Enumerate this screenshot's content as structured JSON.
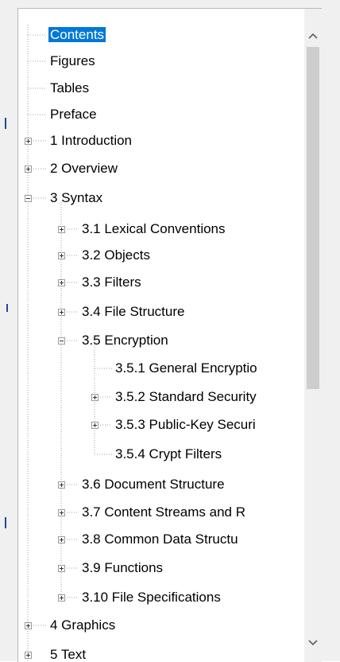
{
  "tree": {
    "nodes": [
      {
        "label": "Contents",
        "selected": true
      },
      {
        "label": "Figures"
      },
      {
        "label": "Tables"
      },
      {
        "label": "Preface"
      },
      {
        "label": "1 Introduction",
        "expander": "collapsed"
      },
      {
        "label": "2 Overview",
        "expander": "collapsed"
      },
      {
        "label": "3 Syntax",
        "expander": "expanded"
      },
      {
        "label": "3.1 Lexical Conventions",
        "expander": "collapsed"
      },
      {
        "label": "3.2 Objects",
        "expander": "collapsed"
      },
      {
        "label": "3.3 Filters",
        "expander": "collapsed"
      },
      {
        "label": "3.4 File Structure",
        "expander": "collapsed"
      },
      {
        "label": "3.5 Encryption",
        "expander": "expanded"
      },
      {
        "label": "3.5.1 General Encryptio"
      },
      {
        "label": "3.5.2 Standard Security",
        "expander": "collapsed"
      },
      {
        "label": "3.5.3 Public-Key Securi",
        "expander": "collapsed"
      },
      {
        "label": "3.5.4 Crypt Filters"
      },
      {
        "label": "3.6 Document Structure",
        "expander": "collapsed"
      },
      {
        "label": "3.7 Content Streams and R",
        "expander": "collapsed"
      },
      {
        "label": "3.8 Common Data Structu",
        "expander": "collapsed"
      },
      {
        "label": "3.9 Functions",
        "expander": "collapsed"
      },
      {
        "label": "3.10 File Specifications",
        "expander": "collapsed"
      },
      {
        "label": "4 Graphics",
        "expander": "collapsed"
      },
      {
        "label": "5 Text",
        "expander": "collapsed"
      }
    ]
  },
  "scrollbar": {
    "up_icon": "chevron-up-icon",
    "down_icon": "chevron-down-icon"
  },
  "colors": {
    "selection": "#0078d7",
    "tree_line": "#a0a0a0",
    "scroll_thumb": "#cdcdcd"
  }
}
